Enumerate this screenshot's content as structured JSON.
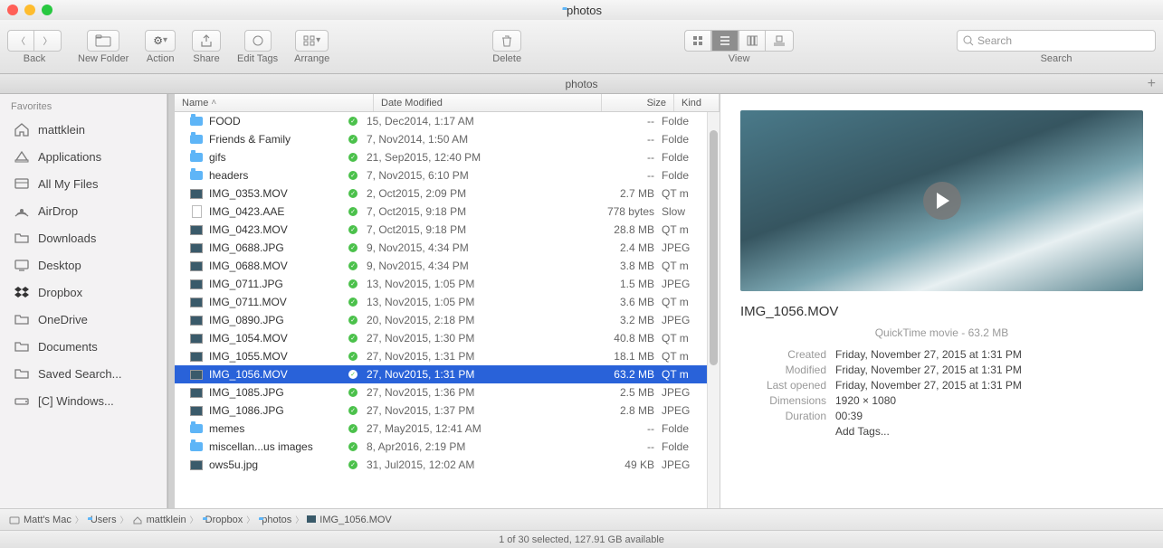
{
  "window": {
    "title": "photos"
  },
  "toolbar": {
    "back": "Back",
    "new_folder": "New Folder",
    "action": "Action",
    "share": "Share",
    "edit_tags": "Edit Tags",
    "arrange": "Arrange",
    "delete": "Delete",
    "view": "View",
    "search_label": "Search",
    "search_placeholder": "Search"
  },
  "tab": {
    "label": "photos"
  },
  "sidebar": {
    "header": "Favorites",
    "items": [
      {
        "label": "mattklein",
        "icon": "home"
      },
      {
        "label": "Applications",
        "icon": "apps"
      },
      {
        "label": "All My Files",
        "icon": "allmyfiles"
      },
      {
        "label": "AirDrop",
        "icon": "airdrop"
      },
      {
        "label": "Downloads",
        "icon": "folder"
      },
      {
        "label": "Desktop",
        "icon": "desktop"
      },
      {
        "label": "Dropbox",
        "icon": "dropbox"
      },
      {
        "label": "OneDrive",
        "icon": "folder"
      },
      {
        "label": "Documents",
        "icon": "folder"
      },
      {
        "label": "Saved Search...",
        "icon": "folder"
      },
      {
        "label": "[C] Windows...",
        "icon": "drive"
      }
    ]
  },
  "columns": {
    "name": "Name",
    "date": "Date Modified",
    "size": "Size",
    "kind": "Kind"
  },
  "files": [
    {
      "name": "FOOD",
      "date": "15, Dec2014, 1:17 AM",
      "size": "--",
      "kind": "Folde",
      "icon": "folder",
      "synced": true
    },
    {
      "name": "Friends & Family",
      "date": "7, Nov2014, 1:50 AM",
      "size": "--",
      "kind": "Folde",
      "icon": "folder",
      "synced": true
    },
    {
      "name": "gifs",
      "date": "21, Sep2015, 12:40 PM",
      "size": "--",
      "kind": "Folde",
      "icon": "folder",
      "synced": true
    },
    {
      "name": "headers",
      "date": "7, Nov2015, 6:10 PM",
      "size": "--",
      "kind": "Folde",
      "icon": "folder",
      "synced": true
    },
    {
      "name": "IMG_0353.MOV",
      "date": "2, Oct2015, 2:09 PM",
      "size": "2.7 MB",
      "kind": "QT m",
      "icon": "thumb",
      "synced": true
    },
    {
      "name": "IMG_0423.AAE",
      "date": "7, Oct2015, 9:18 PM",
      "size": "778 bytes",
      "kind": "Slow",
      "icon": "doc",
      "synced": true
    },
    {
      "name": "IMG_0423.MOV",
      "date": "7, Oct2015, 9:18 PM",
      "size": "28.8 MB",
      "kind": "QT m",
      "icon": "thumb",
      "synced": true
    },
    {
      "name": "IMG_0688.JPG",
      "date": "9, Nov2015, 4:34 PM",
      "size": "2.4 MB",
      "kind": "JPEG",
      "icon": "thumb",
      "synced": true
    },
    {
      "name": "IMG_0688.MOV",
      "date": "9, Nov2015, 4:34 PM",
      "size": "3.8 MB",
      "kind": "QT m",
      "icon": "thumb",
      "synced": true
    },
    {
      "name": "IMG_0711.JPG",
      "date": "13, Nov2015, 1:05 PM",
      "size": "1.5 MB",
      "kind": "JPEG",
      "icon": "thumb",
      "synced": true
    },
    {
      "name": "IMG_0711.MOV",
      "date": "13, Nov2015, 1:05 PM",
      "size": "3.6 MB",
      "kind": "QT m",
      "icon": "thumb",
      "synced": true
    },
    {
      "name": "IMG_0890.JPG",
      "date": "20, Nov2015, 2:18 PM",
      "size": "3.2 MB",
      "kind": "JPEG",
      "icon": "thumb",
      "synced": true
    },
    {
      "name": "IMG_1054.MOV",
      "date": "27, Nov2015, 1:30 PM",
      "size": "40.8 MB",
      "kind": "QT m",
      "icon": "thumb",
      "synced": true
    },
    {
      "name": "IMG_1055.MOV",
      "date": "27, Nov2015, 1:31 PM",
      "size": "18.1 MB",
      "kind": "QT m",
      "icon": "thumb",
      "synced": true
    },
    {
      "name": "IMG_1056.MOV",
      "date": "27, Nov2015, 1:31 PM",
      "size": "63.2 MB",
      "kind": "QT m",
      "icon": "thumb",
      "synced": true,
      "selected": true
    },
    {
      "name": "IMG_1085.JPG",
      "date": "27, Nov2015, 1:36 PM",
      "size": "2.5 MB",
      "kind": "JPEG",
      "icon": "thumb",
      "synced": true
    },
    {
      "name": "IMG_1086.JPG",
      "date": "27, Nov2015, 1:37 PM",
      "size": "2.8 MB",
      "kind": "JPEG",
      "icon": "thumb",
      "synced": true
    },
    {
      "name": "memes",
      "date": "27, May2015, 12:41 AM",
      "size": "--",
      "kind": "Folde",
      "icon": "folder",
      "synced": true
    },
    {
      "name": "miscellan...us images",
      "date": "8, Apr2016, 2:19 PM",
      "size": "--",
      "kind": "Folde",
      "icon": "folder",
      "synced": true
    },
    {
      "name": "ows5u.jpg",
      "date": "31, Jul2015, 12:02 AM",
      "size": "49 KB",
      "kind": "JPEG",
      "icon": "thumb",
      "synced": true
    }
  ],
  "preview": {
    "name": "IMG_1056.MOV",
    "sub": "QuickTime movie - 63.2 MB",
    "created_k": "Created",
    "created_v": "Friday, November 27, 2015 at 1:31 PM",
    "modified_k": "Modified",
    "modified_v": "Friday, November 27, 2015 at 1:31 PM",
    "opened_k": "Last opened",
    "opened_v": "Friday, November 27, 2015 at 1:31 PM",
    "dim_k": "Dimensions",
    "dim_v": "1920 × 1080",
    "dur_k": "Duration",
    "dur_v": "00:39",
    "addtags": "Add Tags..."
  },
  "path": [
    "Matt's Mac",
    "Users",
    "mattklein",
    "Dropbox",
    "photos",
    "IMG_1056.MOV"
  ],
  "status": "1 of 30 selected, 127.91 GB available"
}
